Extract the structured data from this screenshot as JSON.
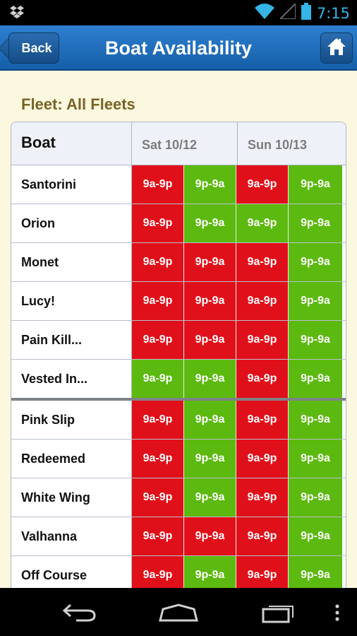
{
  "status_bar": {
    "time": "7:15",
    "icons": [
      "dropbox-icon",
      "wifi-icon",
      "signal-icon",
      "battery-icon"
    ]
  },
  "header": {
    "back_label": "Back",
    "title": "Boat Availability",
    "home_icon": "home-icon"
  },
  "fleet_label": "Fleet: All Fleets",
  "table": {
    "columns": [
      "Boat",
      "Sat 10/12",
      "Sun 10/13"
    ],
    "rows": [
      {
        "boat": "Santorini",
        "slots": [
          [
            "9a-9p",
            "busy"
          ],
          [
            "9p-9a",
            "free"
          ],
          [
            "9a-9p",
            "busy"
          ],
          [
            "9p-9a",
            "free"
          ]
        ]
      },
      {
        "boat": "Orion",
        "slots": [
          [
            "9a-9p",
            "busy"
          ],
          [
            "9p-9a",
            "free"
          ],
          [
            "9a-9p",
            "free"
          ],
          [
            "9p-9a",
            "free"
          ]
        ]
      },
      {
        "boat": "Monet",
        "slots": [
          [
            "9a-9p",
            "busy"
          ],
          [
            "9p-9a",
            "busy"
          ],
          [
            "9a-9p",
            "busy"
          ],
          [
            "9p-9a",
            "free"
          ]
        ]
      },
      {
        "boat": "Lucy!",
        "slots": [
          [
            "9a-9p",
            "busy"
          ],
          [
            "9p-9a",
            "busy"
          ],
          [
            "9a-9p",
            "busy"
          ],
          [
            "9p-9a",
            "free"
          ]
        ]
      },
      {
        "boat": "Pain Kill...",
        "slots": [
          [
            "9a-9p",
            "busy"
          ],
          [
            "9p-9a",
            "busy"
          ],
          [
            "9a-9p",
            "busy"
          ],
          [
            "9p-9a",
            "free"
          ]
        ]
      },
      {
        "boat": "Vested In...",
        "slots": [
          [
            "9a-9p",
            "free"
          ],
          [
            "9p-9a",
            "free"
          ],
          [
            "9a-9p",
            "busy"
          ],
          [
            "9p-9a",
            "free"
          ]
        ]
      },
      {
        "boat": "Pink Slip",
        "slots": [
          [
            "9a-9p",
            "busy"
          ],
          [
            "9p-9a",
            "free"
          ],
          [
            "9a-9p",
            "busy"
          ],
          [
            "9p-9a",
            "free"
          ]
        ]
      },
      {
        "boat": "Redeemed",
        "slots": [
          [
            "9a-9p",
            "busy"
          ],
          [
            "9p-9a",
            "free"
          ],
          [
            "9a-9p",
            "busy"
          ],
          [
            "9p-9a",
            "free"
          ]
        ]
      },
      {
        "boat": "White Wing",
        "slots": [
          [
            "9a-9p",
            "busy"
          ],
          [
            "9p-9a",
            "free"
          ],
          [
            "9a-9p",
            "busy"
          ],
          [
            "9p-9a",
            "free"
          ]
        ]
      },
      {
        "boat": "Valhanna",
        "slots": [
          [
            "9a-9p",
            "busy"
          ],
          [
            "9p-9a",
            "busy"
          ],
          [
            "9a-9p",
            "busy"
          ],
          [
            "9p-9a",
            "free"
          ]
        ]
      },
      {
        "boat": "Off Course",
        "slots": [
          [
            "9a-9p",
            "busy"
          ],
          [
            "9p-9a",
            "free"
          ],
          [
            "9a-9p",
            "busy"
          ],
          [
            "9p-9a",
            "free"
          ]
        ]
      }
    ]
  },
  "colors": {
    "busy": "#e0101a",
    "free": "#5cb90f",
    "action_bar": "#1f6dbd",
    "background": "#fbf8df"
  },
  "nav": [
    "back-nav-icon",
    "home-nav-icon",
    "recents-nav-icon",
    "overflow-menu-icon"
  ]
}
